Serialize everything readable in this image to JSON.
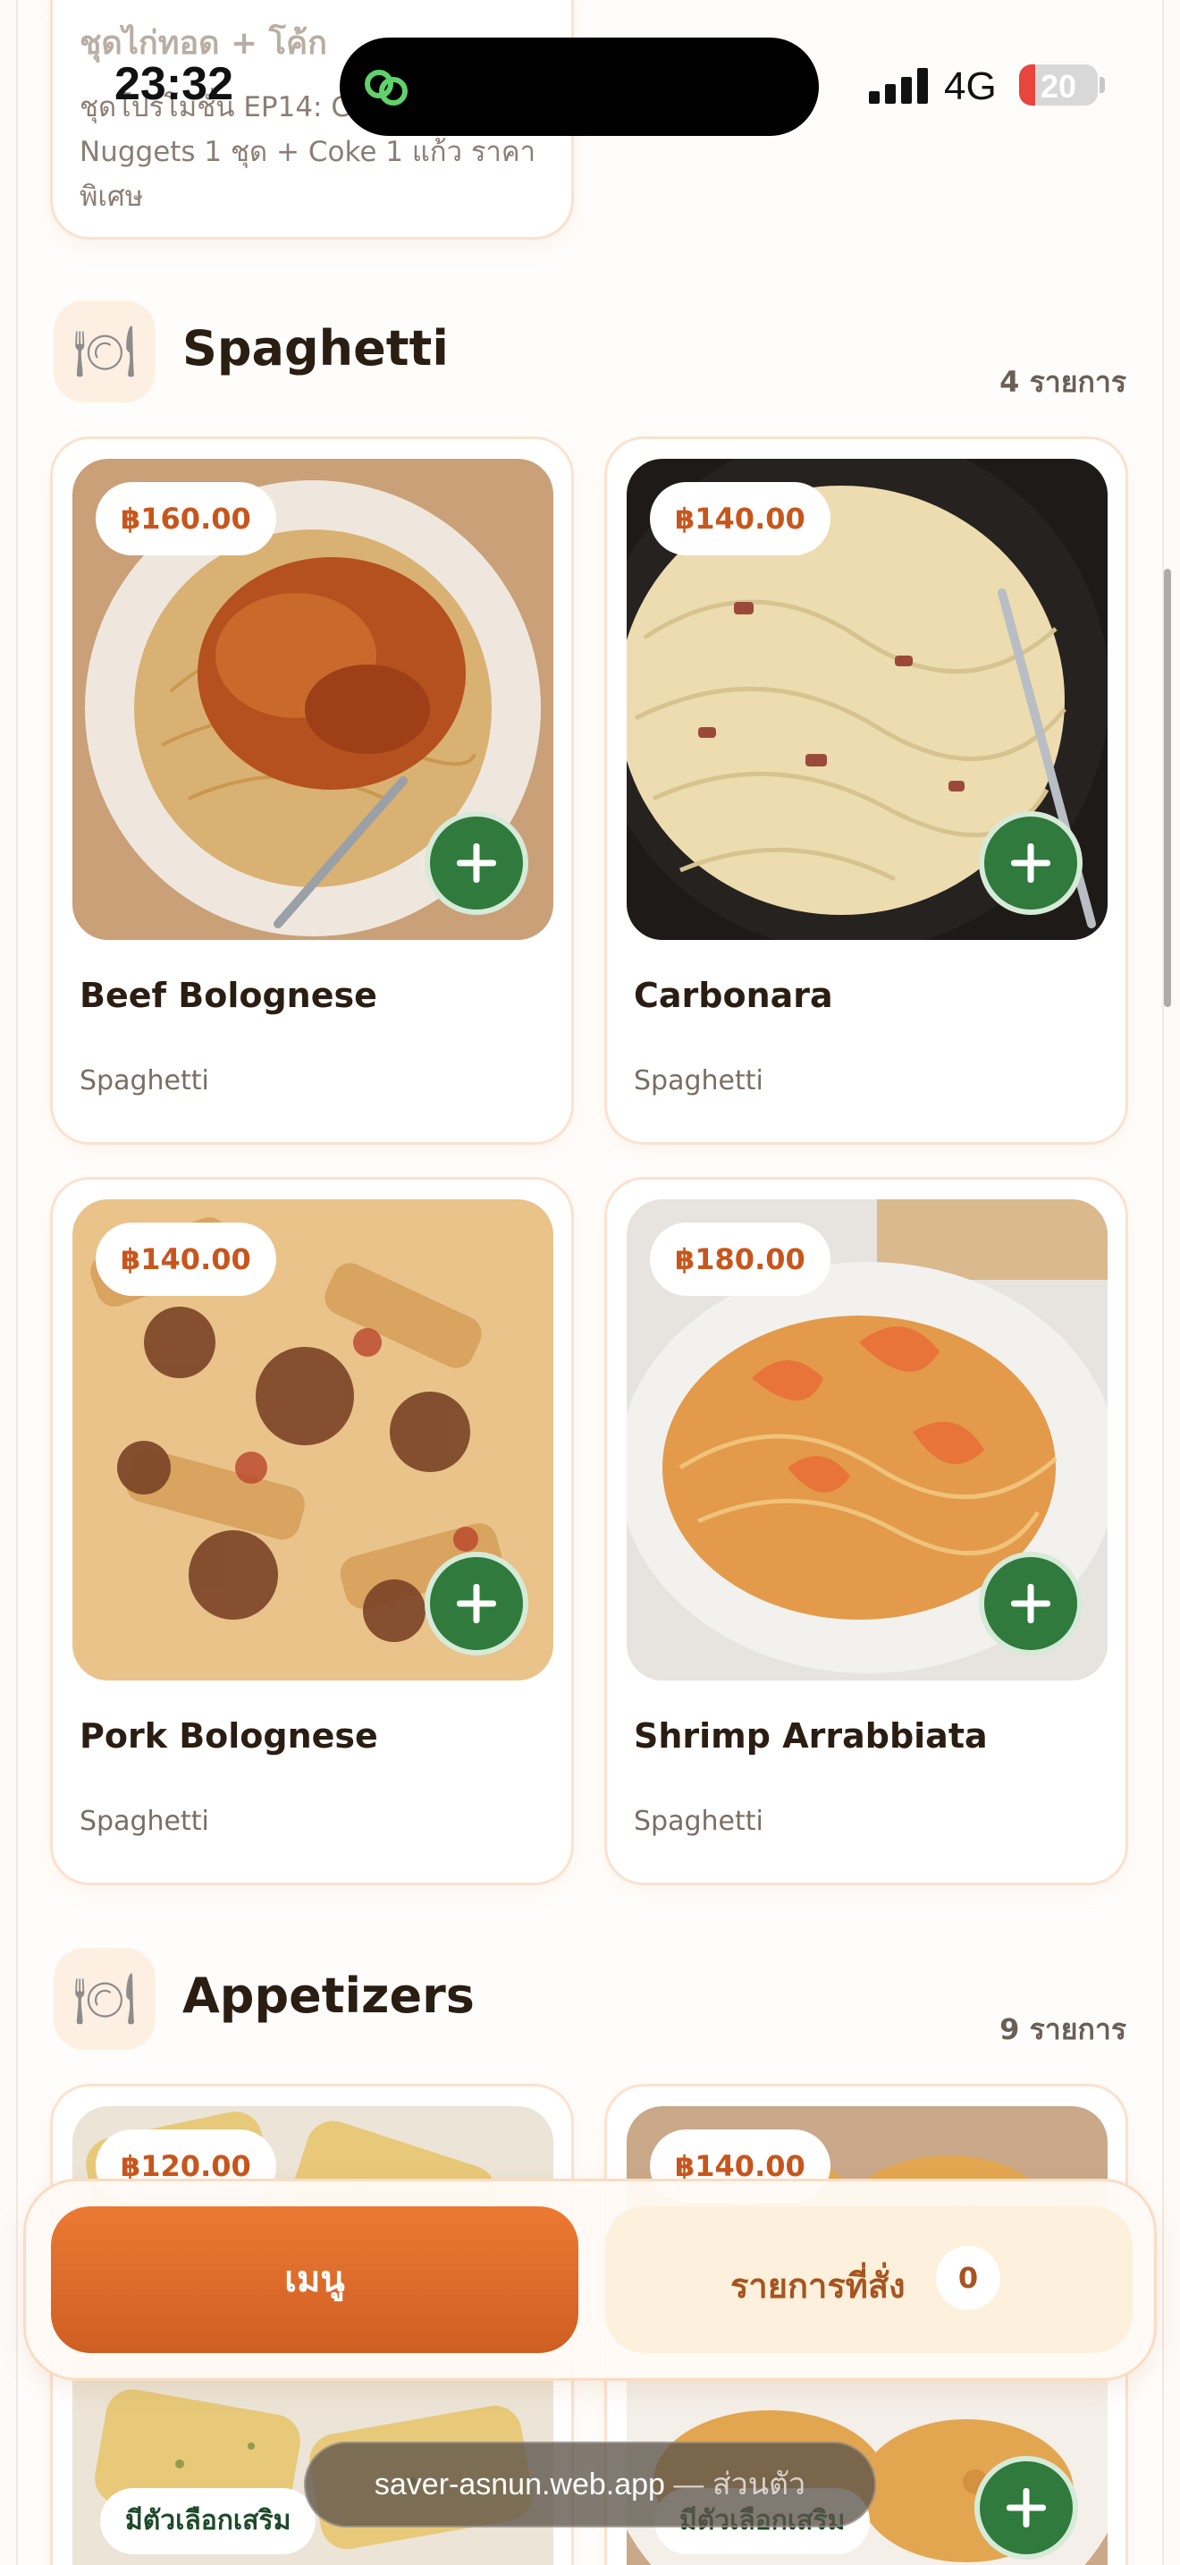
{
  "status_bar": {
    "time": "23:32",
    "network": "4G",
    "battery": "20",
    "battery_level_percent": 20
  },
  "top_partial_item": {
    "name": "ชุดไก่ทอด + โค้ก",
    "description": "ชุดโปรโมชั่น EP14: Chicken Nuggets 1 ชุด + Coke 1 แก้ว ราคาพิเศษ"
  },
  "sections": [
    {
      "icon": "plate-cutlery-icon",
      "title": "Spaghetti",
      "count_label": "4 รายการ",
      "items": [
        {
          "price": "฿160.00",
          "name": "Beef Bolognese",
          "category": "Spaghetti"
        },
        {
          "price": "฿140.00",
          "name": "Carbonara",
          "category": "Spaghetti"
        },
        {
          "price": "฿140.00",
          "name": "Pork Bolognese",
          "category": "Spaghetti"
        },
        {
          "price": "฿180.00",
          "name": "Shrimp Arrabbiata",
          "category": "Spaghetti"
        }
      ]
    },
    {
      "icon": "plate-cutlery-icon",
      "title": "Appetizers",
      "count_label": "9 รายการ",
      "items": [
        {
          "price": "฿120.00",
          "option_badge": "มีตัวเลือกเสริม"
        },
        {
          "price": "฿140.00",
          "option_badge": "มีตัวเลือกเสริม"
        }
      ]
    }
  ],
  "bottom_nav": {
    "menu_label": "เมนู",
    "orders_label": "รายการที่สั่ง",
    "orders_count": "0"
  },
  "url_bar": {
    "host": "saver-asnun.web.app",
    "suffix": " — ส่วนตัว"
  },
  "colors": {
    "accent_orange": "#e2692b",
    "add_button_green": "#2f7a3c",
    "price_text": "#c8561c",
    "card_border": "#fbe2cf"
  }
}
